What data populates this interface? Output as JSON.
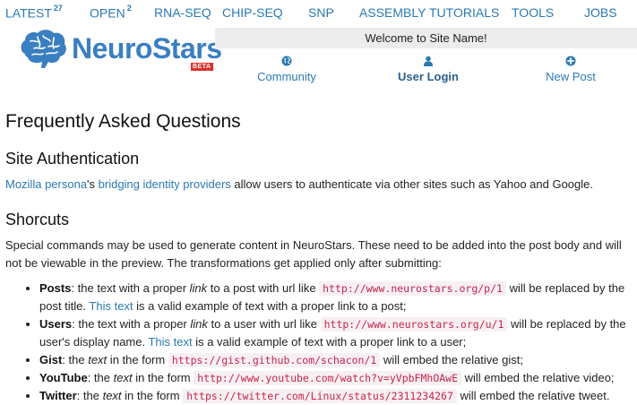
{
  "nav": [
    {
      "label": "LATEST",
      "badge": "27"
    },
    {
      "label": "OPEN",
      "badge": "2"
    },
    {
      "label": "RNA-SEQ"
    },
    {
      "label": "CHIP-SEQ"
    },
    {
      "label": "SNP"
    },
    {
      "label": "ASSEMBLY"
    },
    {
      "label": "TUTORIALS"
    },
    {
      "label": "TOOLS"
    },
    {
      "label": "JOBS"
    }
  ],
  "logo": {
    "text": "NeuroStars",
    "beta": "BETA",
    "icon": "brain-icon"
  },
  "welcome": "Welcome to Site Name!",
  "actions": [
    {
      "label": "Community",
      "icon": "globe-icon"
    },
    {
      "label": "User Login",
      "icon": "user-icon"
    },
    {
      "label": "New Post",
      "icon": "plus-circle-icon"
    }
  ],
  "colors": {
    "link": "#2a7ab0",
    "logo": "#3a7fc1",
    "beta": "#d9332a",
    "code_text": "#c7254e"
  },
  "page": {
    "title": "Frequently Asked Questions",
    "auth": {
      "heading": "Site Authentication",
      "link1": "Mozilla persona",
      "apostrophe": "'s ",
      "link2": "bridging identity providers",
      "rest": " allow users to authenticate via other sites such as Yahoo and Google."
    },
    "shortcuts": {
      "heading": "Shorcuts",
      "intro": "Special commands may be used to generate content in NeuroStars. These need to be added into the post body and will not be viewable in the preview. The transformations get applied only after submitting:",
      "items": [
        {
          "name": "Posts",
          "t1": ": the text with a proper ",
          "em": "link",
          "t2": " to a post with url like ",
          "code": "http://www.neurostars.org/p/1",
          "t3": " will be replaced by the post title. ",
          "link": "This text",
          "t4": " is a valid example of text with a proper link to a post;"
        },
        {
          "name": "Users",
          "t1": ": the text with a proper ",
          "em": "link",
          "t2": " to a user with url like ",
          "code": "http://www.neurostars.org/u/1",
          "t3": " will be replaced by the user's display name. ",
          "link": "This text",
          "t4": " is a valid example of text with a proper link to a user;"
        },
        {
          "name": "Gist",
          "t1": ": the ",
          "em": "text",
          "t2": " in the form ",
          "code": "https://gist.github.com/schacon/1",
          "t3": " will embed the relative gist;"
        },
        {
          "name": "YouTube",
          "t1": ": the ",
          "em": "text",
          "t2": " in the form ",
          "code": "http://www.youtube.com/watch?v=yVpbFMhOAwE",
          "t3": " will embed the relative video;"
        },
        {
          "name": "Twitter",
          "t1": ": the ",
          "em": "text",
          "t2": " in the form ",
          "code": "https://twitter.com/Linux/status/2311234267",
          "t3": " will embed the relative tweet."
        }
      ]
    }
  }
}
